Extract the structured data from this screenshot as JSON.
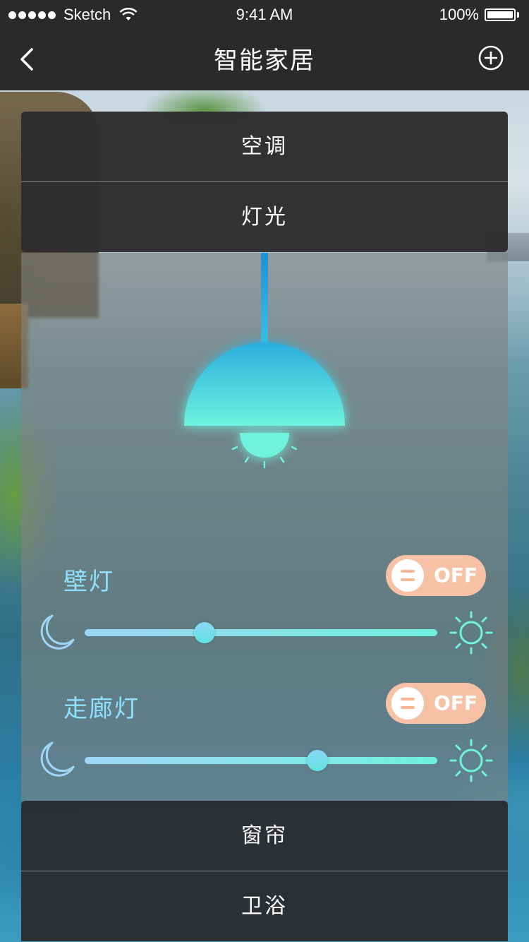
{
  "status_bar": {
    "carrier": "Sketch",
    "time": "9:41 AM",
    "battery": "100%"
  },
  "nav": {
    "title": "智能家居",
    "back_icon": "chevron-left-icon",
    "add_icon": "plus-circle-icon"
  },
  "menu": {
    "items": [
      {
        "label": "空调",
        "expanded": false
      },
      {
        "label": "灯光",
        "expanded": true
      },
      {
        "label": "窗帘",
        "expanded": false
      },
      {
        "label": "卫浴",
        "expanded": false
      }
    ]
  },
  "lights": [
    {
      "name": "壁灯",
      "toggle_label": "OFF",
      "on": false,
      "brightness": 0.34
    },
    {
      "name": "走廊灯",
      "toggle_label": "OFF",
      "on": false,
      "brightness": 0.66
    }
  ],
  "colors": {
    "accent_cyan": "#5fe3e0",
    "label_blue": "#8fe0ff",
    "toggle_off": "#f6c1a5",
    "bar_dark": "#2a2a2a"
  },
  "icons": {
    "min_brightness": "moon-icon",
    "max_brightness": "sun-icon",
    "lamp": "pendant-lamp-icon"
  }
}
